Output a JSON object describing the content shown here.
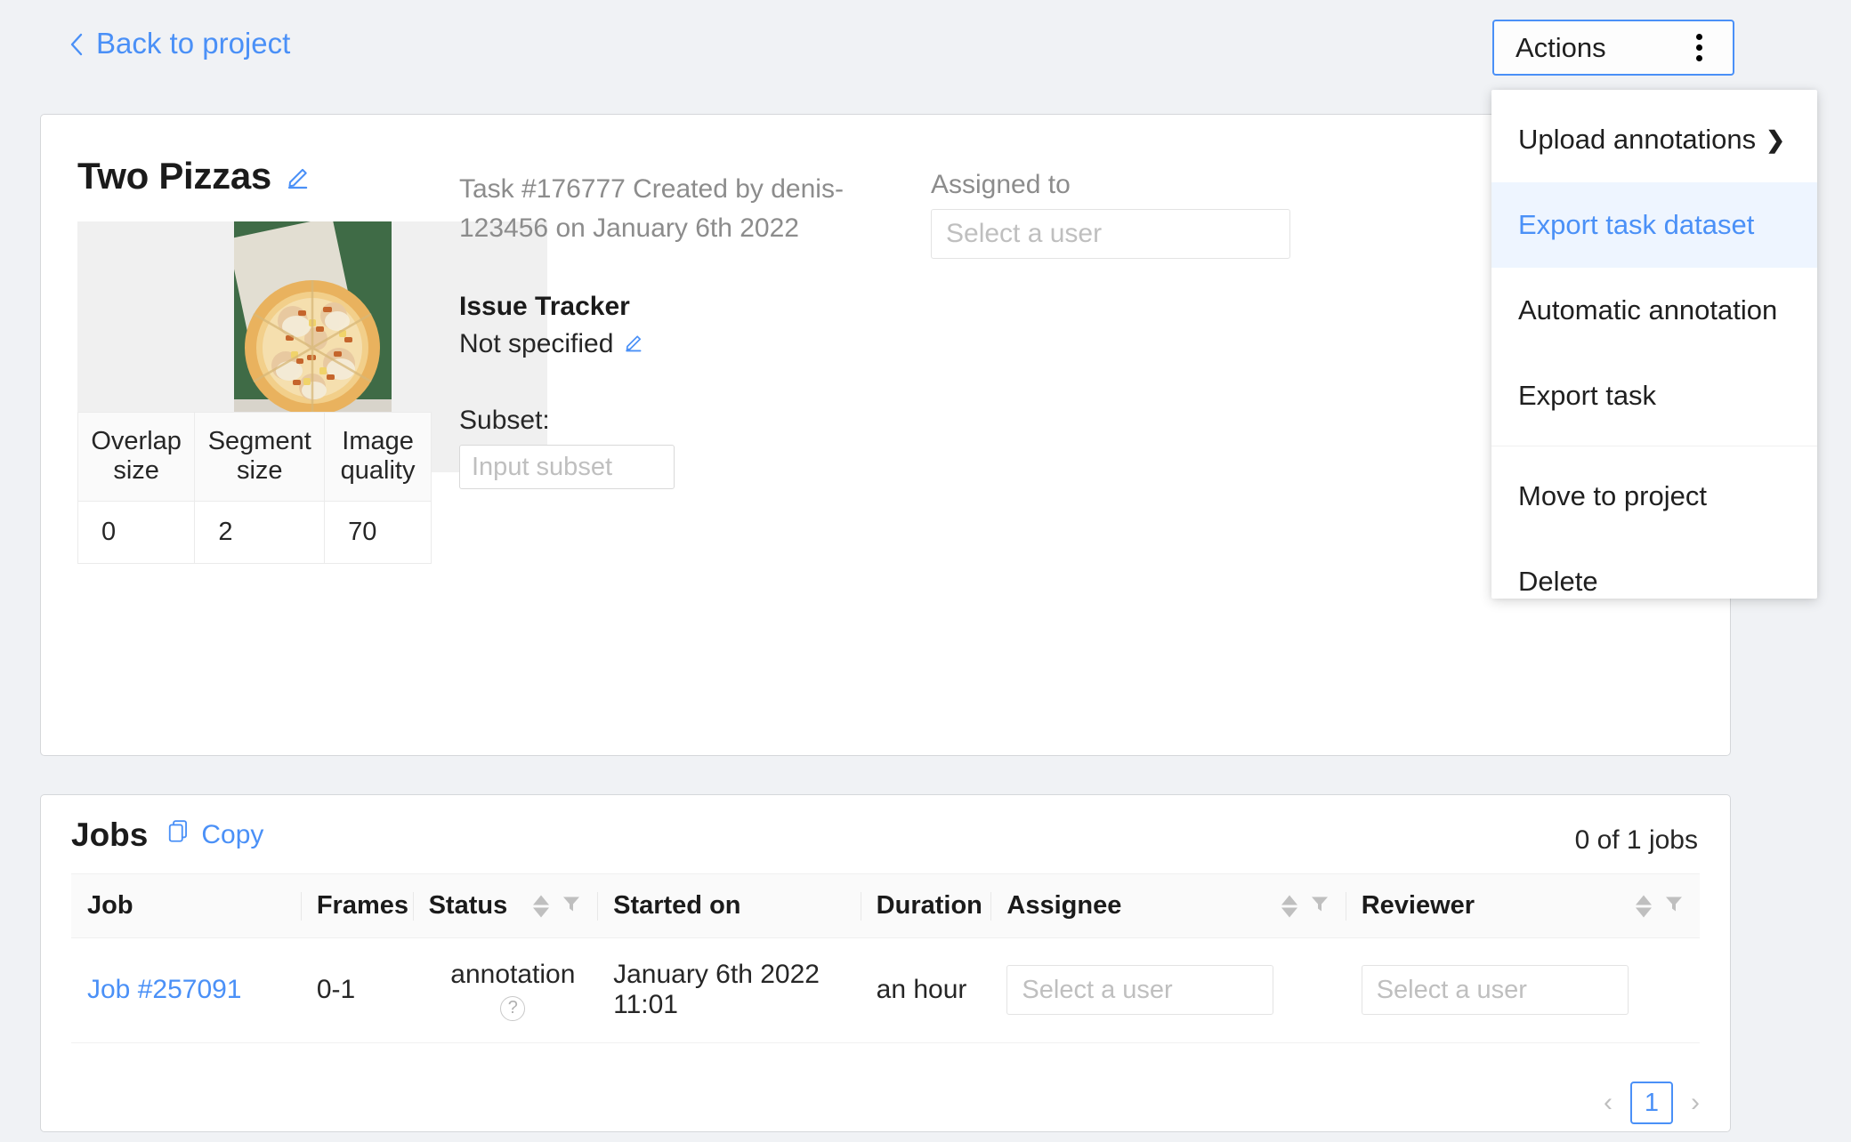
{
  "topbar": {
    "back_label": "Back to project",
    "back_icon": "chevron-left-icon",
    "actions_label": "Actions",
    "actions_icon": "three-dots-vertical-icon"
  },
  "actions_menu": {
    "items": [
      {
        "label": "Upload annotations",
        "submenu": true,
        "submenu_icon": "chevron-right-icon",
        "highlight": false,
        "divider_after": false
      },
      {
        "label": "Export task dataset",
        "submenu": false,
        "highlight": true,
        "divider_after": false
      },
      {
        "label": "Automatic annotation",
        "submenu": false,
        "highlight": false,
        "divider_after": false
      },
      {
        "label": "Export task",
        "submenu": false,
        "highlight": false,
        "divider_after": true
      },
      {
        "label": "Move to project",
        "submenu": false,
        "highlight": false,
        "divider_after": false
      },
      {
        "label": "Delete",
        "submenu": false,
        "highlight": false,
        "divider_after": false
      }
    ]
  },
  "task": {
    "title": "Two Pizzas",
    "title_edit_icon": "pencil-edit-icon",
    "thumbnail_alt": "pizza-thumbnail",
    "created_line": "Task #176777 Created by denis-123456 on January 6th 2022",
    "issue_tracker_label": "Issue Tracker",
    "issue_tracker_value": "Not specified",
    "issue_tracker_edit_icon": "pencil-edit-icon",
    "subset_label": "Subset:",
    "subset_value": "",
    "subset_placeholder": "Input subset",
    "assigned_label": "Assigned to",
    "assigned_value": "",
    "assigned_placeholder": "Select a user",
    "params": {
      "headers": [
        "Overlap size",
        "Segment size",
        "Image quality"
      ],
      "values": [
        "0",
        "2",
        "70"
      ]
    }
  },
  "jobs": {
    "title": "Jobs",
    "copy_label": "Copy",
    "copy_icon": "copy-icon",
    "count_label": "0 of 1 jobs",
    "columns": [
      {
        "label": "Job",
        "sortable": false,
        "filterable": false
      },
      {
        "label": "Frames",
        "sortable": false,
        "filterable": false
      },
      {
        "label": "Status",
        "sortable": true,
        "filterable": true
      },
      {
        "label": "Started on",
        "sortable": false,
        "filterable": false
      },
      {
        "label": "Duration",
        "sortable": false,
        "filterable": false
      },
      {
        "label": "Assignee",
        "sortable": true,
        "filterable": true
      },
      {
        "label": "Reviewer",
        "sortable": true,
        "filterable": true
      }
    ],
    "rows": [
      {
        "job": "Job #257091",
        "frames": "0-1",
        "status": "annotation",
        "status_help_icon": "question-circle-icon",
        "started_on": "January 6th 2022 11:01",
        "duration": "an hour",
        "assignee_placeholder": "Select a user",
        "assignee_value": "",
        "reviewer_placeholder": "Select a user",
        "reviewer_value": ""
      }
    ],
    "pagination": {
      "prev_icon": "chevron-left-icon",
      "next_icon": "chevron-right-icon",
      "current_page": "1"
    }
  },
  "colors": {
    "accent": "#4a90f7",
    "page_bg": "#f0f2f5",
    "card_bg": "#ffffff",
    "muted_text": "#8c8c8c",
    "placeholder": "#bfbfbf",
    "highlight_bg": "#eef5ff"
  }
}
